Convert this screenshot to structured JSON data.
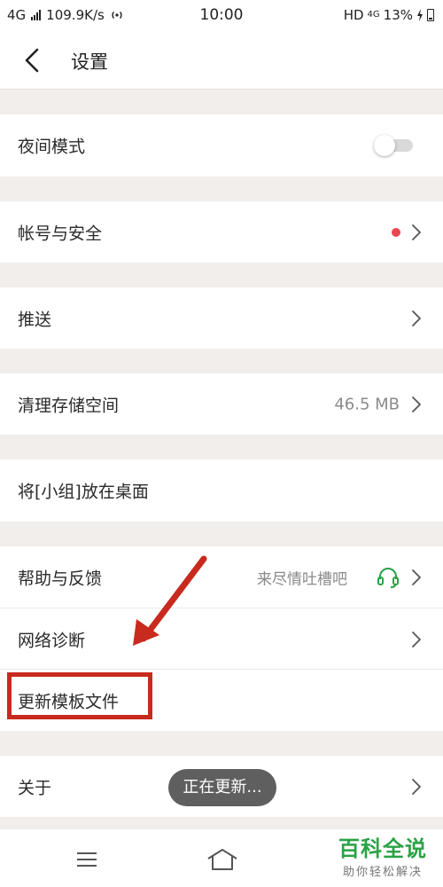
{
  "status_bar": {
    "network": "4G",
    "speed": "109.9K/s",
    "time": "10:00",
    "hd": "HD",
    "network_right": "4G",
    "battery": "13%"
  },
  "header": {
    "title": "设置"
  },
  "settings": {
    "night_mode": {
      "label": "夜间模式",
      "toggle_on": false
    },
    "account": {
      "label": "帐号与安全"
    },
    "push": {
      "label": "推送"
    },
    "storage": {
      "label": "清理存储空间",
      "value": "46.5 MB"
    },
    "desktop": {
      "label": "将[小组]放在桌面"
    },
    "help": {
      "label": "帮助与反馈",
      "value": "来尽情吐槽吧"
    },
    "diagnose": {
      "label": "网络诊断"
    },
    "update_template": {
      "label": "更新模板文件"
    },
    "about": {
      "label": "关于"
    }
  },
  "toast": {
    "text": "正在更新..."
  },
  "watermark": {
    "main": "百科全说",
    "sub": "助你轻松解决"
  },
  "colors": {
    "accent_red": "#c82a1e",
    "badge_red": "#e8474f",
    "headset_green": "#2aa246",
    "watermark_green": "#2aa246"
  },
  "icons": [
    "back-arrow-icon",
    "chevron-right-icon",
    "headset-icon",
    "wifi-call-icon",
    "charging-icon",
    "menu-icon",
    "home-icon"
  ]
}
